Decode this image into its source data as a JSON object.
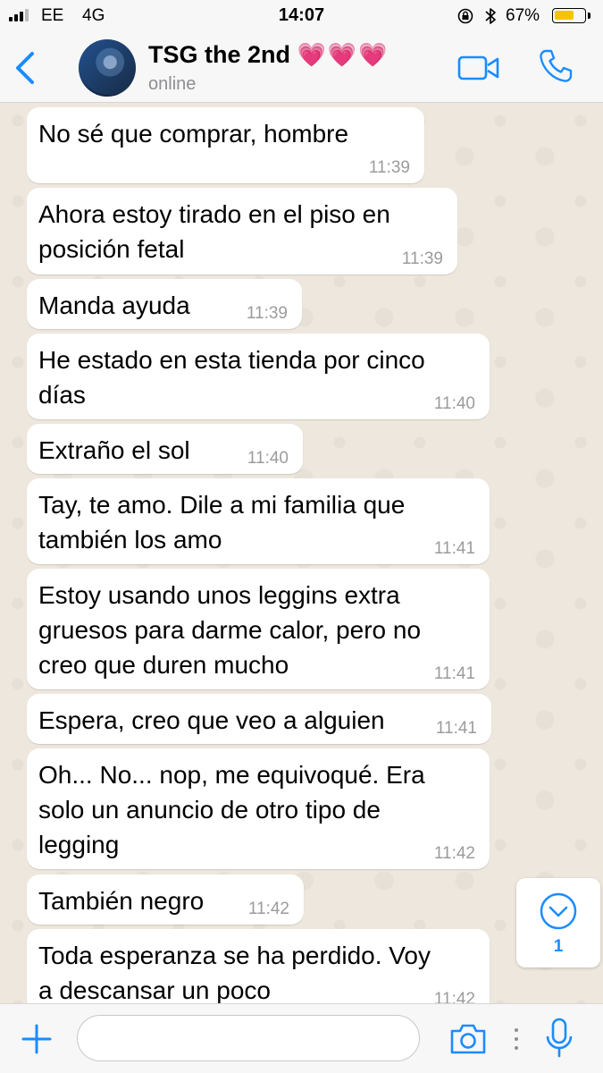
{
  "status_bar": {
    "carrier": "EE",
    "network": "4G",
    "time": "14:07",
    "battery_percent": "67%",
    "battery_level": 0.67,
    "icons": [
      "signal-icon",
      "lock-rotation-icon",
      "bluetooth-icon",
      "battery-icon"
    ]
  },
  "header": {
    "contact_name": "TSG the 2nd",
    "name_emoji": "💗💗💗",
    "status": "online",
    "icons": [
      "back-chevron-icon",
      "video-camera-icon",
      "phone-icon"
    ]
  },
  "messages": [
    {
      "text": "No sé que comprar, hombre",
      "time": "11:39"
    },
    {
      "text": "Ahora estoy tirado en el piso en\nposición fetal",
      "time": "11:39"
    },
    {
      "text": "Manda ayuda",
      "time": "11:39"
    },
    {
      "text": "He estado en esta tienda por cinco\ndías",
      "time": "11:40"
    },
    {
      "text": "Extraño el sol",
      "time": "11:40"
    },
    {
      "text": "Tay, te amo. Dile a mi familia que\ntambién los amo",
      "time": "11:41"
    },
    {
      "text": "Estoy usando unos leggins extra\ngruesos para darme calor, pero no\ncreo que duren mucho",
      "time": "11:41"
    },
    {
      "text": "Espera, creo que veo a alguien",
      "time": "11:41"
    },
    {
      "text": "Oh... No... nop, me equivoqué. Era\nsolo un anuncio de otro tipo de\nlegging",
      "time": "11:42"
    },
    {
      "text": "También negro",
      "time": "11:42"
    },
    {
      "text": "Toda esperanza se ha perdido. Voy\na descansar un poco",
      "time": "11:42"
    }
  ],
  "scroll_down": {
    "unread_count": "1"
  },
  "composer": {
    "input_value": "",
    "icons": [
      "plus-icon",
      "camera-icon",
      "more-dots-icon",
      "microphone-icon"
    ]
  },
  "colors": {
    "accent": "#1a8cff",
    "battery": "#f5c400",
    "bubble": "#ffffff",
    "background": "#ede7dd"
  }
}
